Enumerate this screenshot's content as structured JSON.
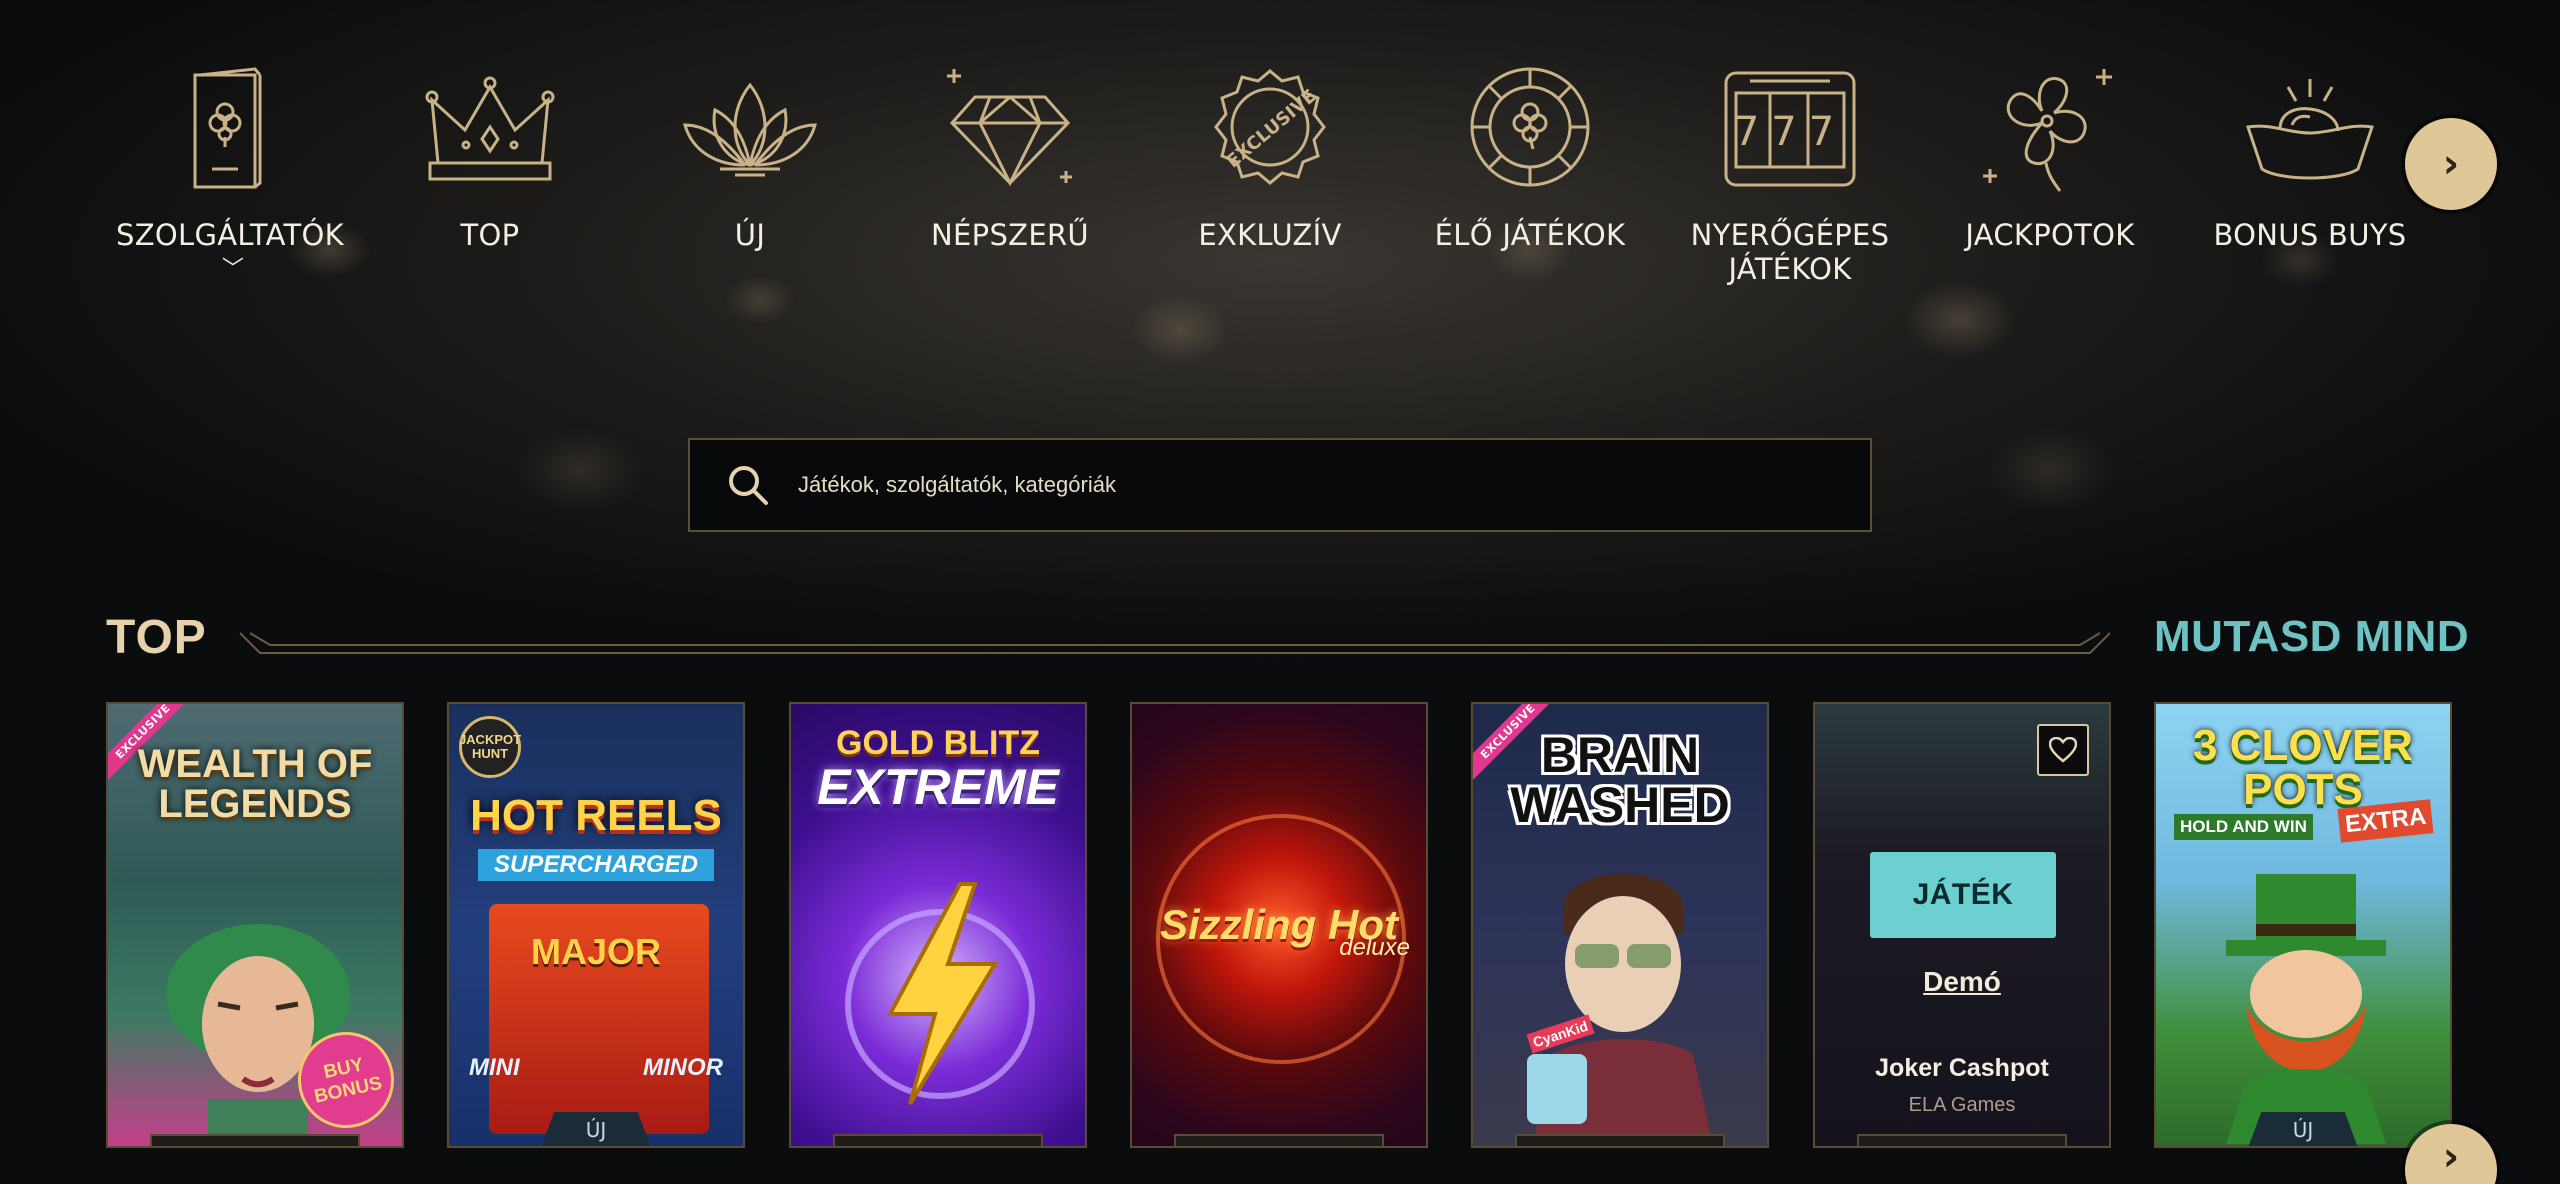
{
  "categories": [
    {
      "label": "SZOLGÁLTATÓK",
      "icon": "card-clover-icon",
      "has_dropdown": true
    },
    {
      "label": "TOP",
      "icon": "crown-icon"
    },
    {
      "label": "ÚJ",
      "icon": "lotus-icon"
    },
    {
      "label": "NÉPSZERŰ",
      "icon": "diamond-icon"
    },
    {
      "label": "EXKLUZÍV",
      "icon": "exclusive-badge-icon",
      "badge_text": "EXCLUSIVE"
    },
    {
      "label": "ÉLŐ JÁTÉKOK",
      "icon": "chip-clover-icon"
    },
    {
      "label": "NYERŐGÉPES\nJÁTÉKOK",
      "icon": "slot-777-icon",
      "slot_text": "777"
    },
    {
      "label": "JACKPOTOK",
      "icon": "clover-sparkle-icon"
    },
    {
      "label": "BONUS BUYS",
      "icon": "gold-ingot-icon"
    }
  ],
  "nav_next": "›",
  "search": {
    "placeholder": "Játékok, szolgáltatók, kategóriák"
  },
  "section": {
    "title": "TOP",
    "show_all": "MUTASD MIND"
  },
  "games": [
    {
      "art_title": "WEALTH OF LEGENDS",
      "ribbon": "EXCLUSIVE",
      "badge": "BUY BONUS"
    },
    {
      "art_title": "HOT REELS",
      "art_subtitle": "SUPERCHARGED",
      "logo": "JACKPOT HUNT",
      "art_extra": [
        "MAJOR",
        "MINI",
        "MINOR"
      ],
      "tag": "ÚJ"
    },
    {
      "art_title": "GOLD BLITZ",
      "art_subtitle": "EXTREME"
    },
    {
      "art_title": "Sizzling Hot",
      "art_subtitle": "deluxe"
    },
    {
      "art_title": "BRAIN WASHED",
      "ribbon": "EXCLUSIVE",
      "art_extra": [
        "CyanKid"
      ]
    },
    {
      "play_label": "JÁTÉK",
      "demo_label": "Demó",
      "name": "Joker Cashpot",
      "provider": "ELA Games"
    },
    {
      "art_title": "3 CLOVER POTS",
      "art_subtitle": "HOLD AND WIN",
      "art_extra": [
        "EXTRA"
      ],
      "tag": "ÚJ"
    }
  ],
  "cards_next": "›",
  "colors": {
    "gold": "#d9c28f",
    "teal": "#6fc2c4",
    "play_button": "#6ccfd0",
    "background": "#0b0c0e"
  }
}
